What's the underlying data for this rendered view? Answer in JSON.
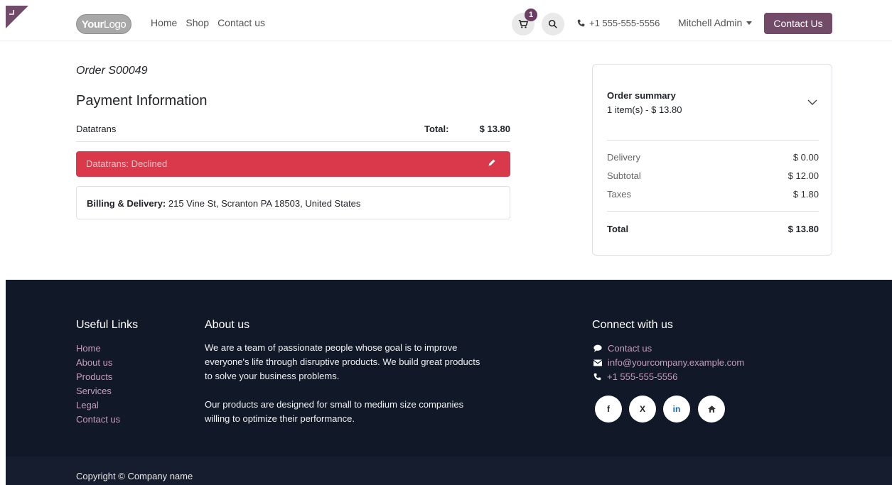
{
  "header": {
    "logo_brand": "Your",
    "logo_rest": "Logo",
    "nav": [
      "Home",
      "Shop",
      "Contact us"
    ],
    "cart_count": "1",
    "phone": "+1 555-555-5556",
    "user": "Mitchell Admin",
    "cta": "Contact Us"
  },
  "order": {
    "title": "Order S00049",
    "payment_title": "Payment Information",
    "provider": "Datatrans",
    "total_label": "Total:",
    "total_value": "$ 13.80",
    "status": "Datatrans: Declined",
    "billing_label": "Billing & Delivery:",
    "billing_address": "215 Vine St, Scranton PA 18503, United States"
  },
  "summary": {
    "title": "Order summary",
    "subtitle": "1 item(s) -  $ 13.80",
    "rows": [
      {
        "label": "Delivery",
        "value": "$ 0.00"
      },
      {
        "label": "Subtotal",
        "value": "$ 12.00"
      },
      {
        "label": "Taxes",
        "value": "$ 1.80"
      }
    ],
    "total_label": "Total",
    "total_value": "$ 13.80"
  },
  "footer": {
    "useful_title": "Useful Links",
    "useful_links": [
      "Home",
      "About us",
      "Products",
      "Services",
      "Legal",
      "Contact us"
    ],
    "about_title": "About us",
    "about_p1": [
      "We are a team of passionate people whose goal is to improve",
      "everyone's life through disruptive products. We build great products",
      "to solve your business problems."
    ],
    "about_p2": [
      "Our products are designed for small to medium size companies",
      "willing to optimize their performance."
    ],
    "connect_title": "Connect with us",
    "connect": [
      "Contact us",
      "info@yourcompany.example.com",
      "+1 555-555-5556"
    ],
    "social": [
      "f",
      "X",
      "in"
    ],
    "copyright": "Copyright © Company name"
  }
}
